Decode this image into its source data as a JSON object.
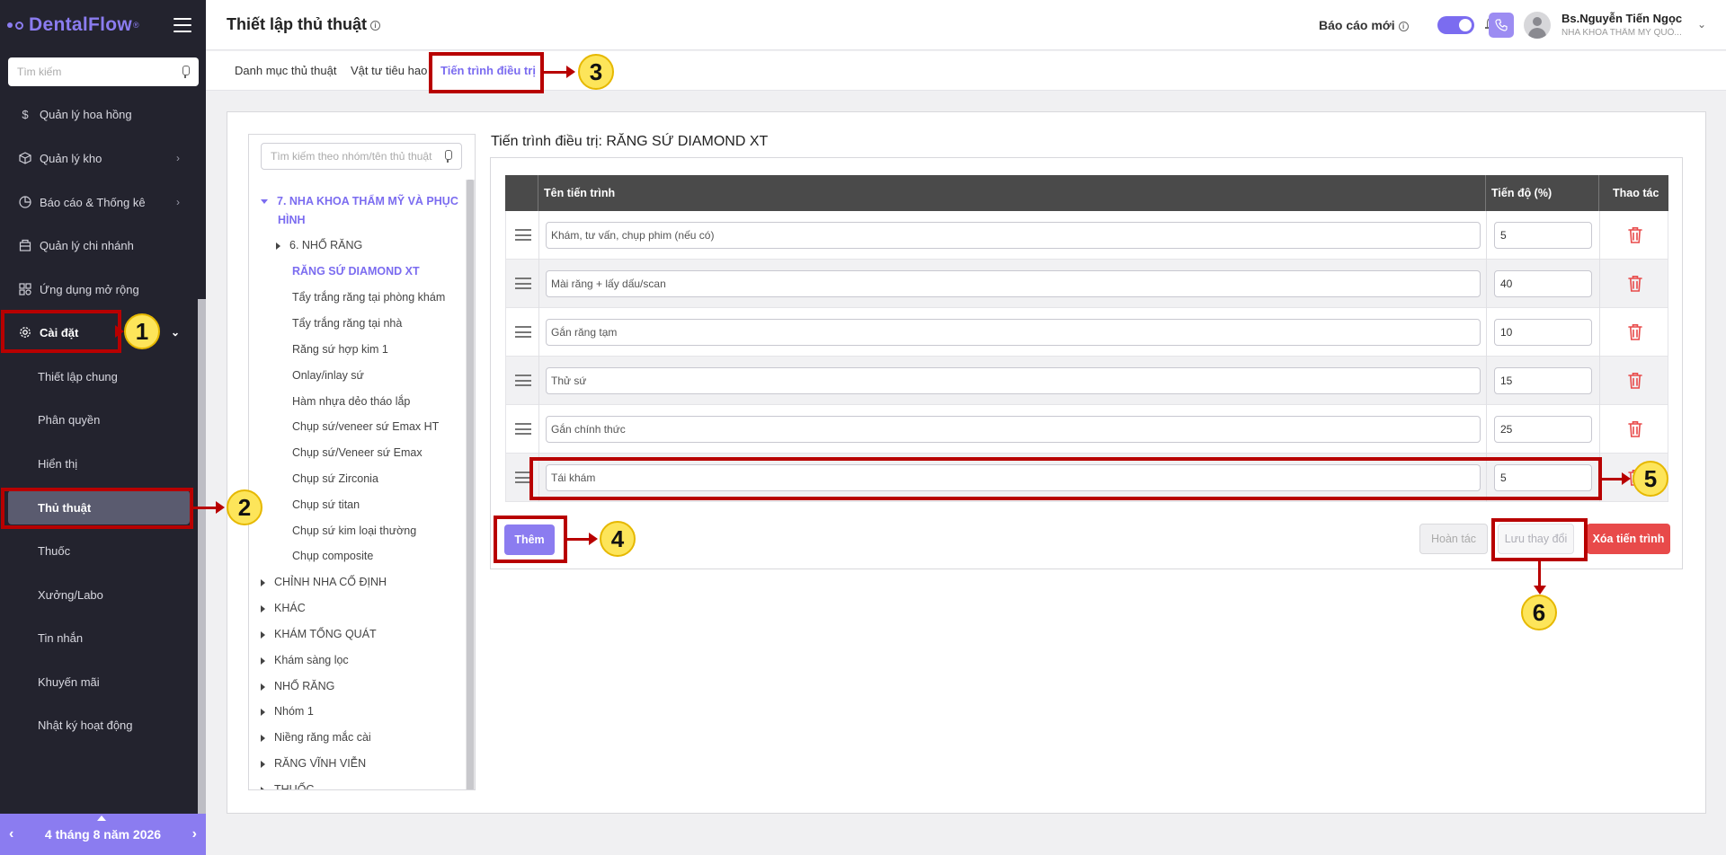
{
  "app": {
    "name": "DentalFlow",
    "reg": "®"
  },
  "sidebar": {
    "search_placeholder": "Tìm kiếm",
    "items": [
      {
        "label": "Quản lý hoa hồng"
      },
      {
        "label": "Quản lý kho"
      },
      {
        "label": "Báo cáo & Thống kê"
      },
      {
        "label": "Quản lý chi nhánh"
      },
      {
        "label": "Ứng dụng mở rộng"
      },
      {
        "label": "Cài đặt"
      }
    ],
    "sub_items": [
      {
        "label": "Thiết lập chung"
      },
      {
        "label": "Phân quyền"
      },
      {
        "label": "Hiển thị"
      },
      {
        "label": "Thủ thuật"
      },
      {
        "label": "Thuốc"
      },
      {
        "label": "Xưởng/Labo"
      },
      {
        "label": "Tin nhắn"
      },
      {
        "label": "Khuyến mãi"
      },
      {
        "label": "Nhật ký hoạt động"
      }
    ],
    "date": "4 tháng 8 năm 2026"
  },
  "header": {
    "title": "Thiết lập thủ thuật",
    "report_label": "Báo cáo mới",
    "report_toggle_on": true,
    "user_name": "Bs.Nguyễn Tiến Ngọc",
    "user_clinic": "NHA KHOA THẨM MỸ QUỐ..."
  },
  "tabs": [
    {
      "label": "Danh mục thủ thuật"
    },
    {
      "label": "Vật tư tiêu hao"
    },
    {
      "label": "Tiến trình điều trị"
    }
  ],
  "tree": {
    "search_placeholder": "Tìm kiếm theo nhóm/tên thủ thuật",
    "nodes": [
      {
        "label": "7. NHA KHOA THẨM MỸ VÀ PHỤC"
      },
      {
        "label": "HÌNH"
      },
      {
        "label": "6. NHỔ RĂNG"
      },
      {
        "label": "RĂNG SỨ DIAMOND XT"
      },
      {
        "label": "Tẩy trắng răng tại phòng khám"
      },
      {
        "label": "Tẩy trắng răng tại nhà"
      },
      {
        "label": "Răng sứ hợp kim 1"
      },
      {
        "label": "Onlay/inlay sứ"
      },
      {
        "label": "Hàm nhựa dẻo tháo lắp"
      },
      {
        "label": "Chụp sứ/veneer sứ Emax HT"
      },
      {
        "label": "Chụp sứ/Veneer sứ Emax"
      },
      {
        "label": "Chụp sứ Zirconia"
      },
      {
        "label": "Chụp sứ titan"
      },
      {
        "label": "Chụp sứ kim loại thường"
      },
      {
        "label": "Chụp composite"
      },
      {
        "label": "CHỈNH NHA CỐ ĐỊNH"
      },
      {
        "label": "KHÁC"
      },
      {
        "label": "KHÁM TỔNG QUÁT"
      },
      {
        "label": "Khám sàng lọc"
      },
      {
        "label": "NHỔ RĂNG"
      },
      {
        "label": "Nhóm 1"
      },
      {
        "label": "Niềng răng mắc cài"
      },
      {
        "label": "RĂNG VĨNH VIỄN"
      },
      {
        "label": "THUỐC"
      }
    ]
  },
  "process": {
    "title_prefix": "Tiến trình điều trị: ",
    "title_name": "RĂNG SỨ DIAMOND XT",
    "col_name": "Tên tiến trình",
    "col_pct": "Tiến độ (%)",
    "col_action": "Thao tác",
    "rows": [
      {
        "name": "Khám, tư vấn, chụp phim (nếu có)",
        "pct": "5"
      },
      {
        "name": "Mài răng + lấy dấu/scan",
        "pct": "40"
      },
      {
        "name": "Gắn răng tạm",
        "pct": "10"
      },
      {
        "name": "Thử sứ",
        "pct": "15"
      },
      {
        "name": "Gắn chính thức",
        "pct": "25"
      },
      {
        "name": "Tái khám",
        "pct": "5"
      }
    ],
    "btn_add": "Thêm",
    "btn_undo": "Hoàn tác",
    "btn_save": "Lưu thay đổi",
    "btn_delete": "Xóa tiến trình"
  },
  "annotations": [
    "1",
    "2",
    "3",
    "4",
    "5",
    "6"
  ],
  "colors": {
    "accent": "#8b7cf0",
    "annotation": "#b80000",
    "badge": "#fde55a",
    "danger": "#e84a4a",
    "sidebar_bg": "#23232e"
  }
}
